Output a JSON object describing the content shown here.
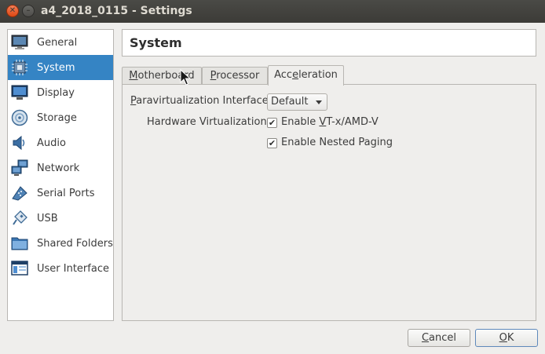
{
  "window": {
    "title": "a4_2018_0115 - Settings",
    "close_glyph": "✕",
    "min_glyph": "–"
  },
  "sidebar": {
    "items": [
      {
        "label": "General",
        "icon": "monitor-icon"
      },
      {
        "label": "System",
        "icon": "chip-icon",
        "selected": true
      },
      {
        "label": "Display",
        "icon": "display-icon"
      },
      {
        "label": "Storage",
        "icon": "disk-icon"
      },
      {
        "label": "Audio",
        "icon": "speaker-icon"
      },
      {
        "label": "Network",
        "icon": "network-icon"
      },
      {
        "label": "Serial Ports",
        "icon": "serial-port-icon"
      },
      {
        "label": "USB",
        "icon": "usb-icon"
      },
      {
        "label": "Shared Folders",
        "icon": "folder-icon"
      },
      {
        "label": "User Interface",
        "icon": "window-icon"
      }
    ]
  },
  "header": {
    "title": "System"
  },
  "tabs": [
    {
      "label_pre": "",
      "label_ul": "M",
      "label_post": "otherboard"
    },
    {
      "label_pre": "",
      "label_ul": "P",
      "label_post": "rocessor"
    },
    {
      "label_pre": "Acc",
      "label_ul": "e",
      "label_post": "leration",
      "active": true
    }
  ],
  "acceleration": {
    "paravirt_label_ul": "P",
    "paravirt_label_rest": "aravirtualization Interface:",
    "paravirt_value": "Default",
    "hw_virt_label": "Hardware Virtualization:",
    "vtx_pre": "Enable ",
    "vtx_ul": "V",
    "vtx_post": "T-x/AMD-V",
    "vtx_checked": true,
    "nested_label": "Enable Nested Paging",
    "nested_checked": true,
    "check_glyph": "✔"
  },
  "buttons": {
    "cancel_ul": "C",
    "cancel_rest": "ancel",
    "ok_ul": "O",
    "ok_rest": "K"
  },
  "colors": {
    "selection": "#3584c4",
    "titlebar": "#3c3b37",
    "background": "#efeeec"
  }
}
